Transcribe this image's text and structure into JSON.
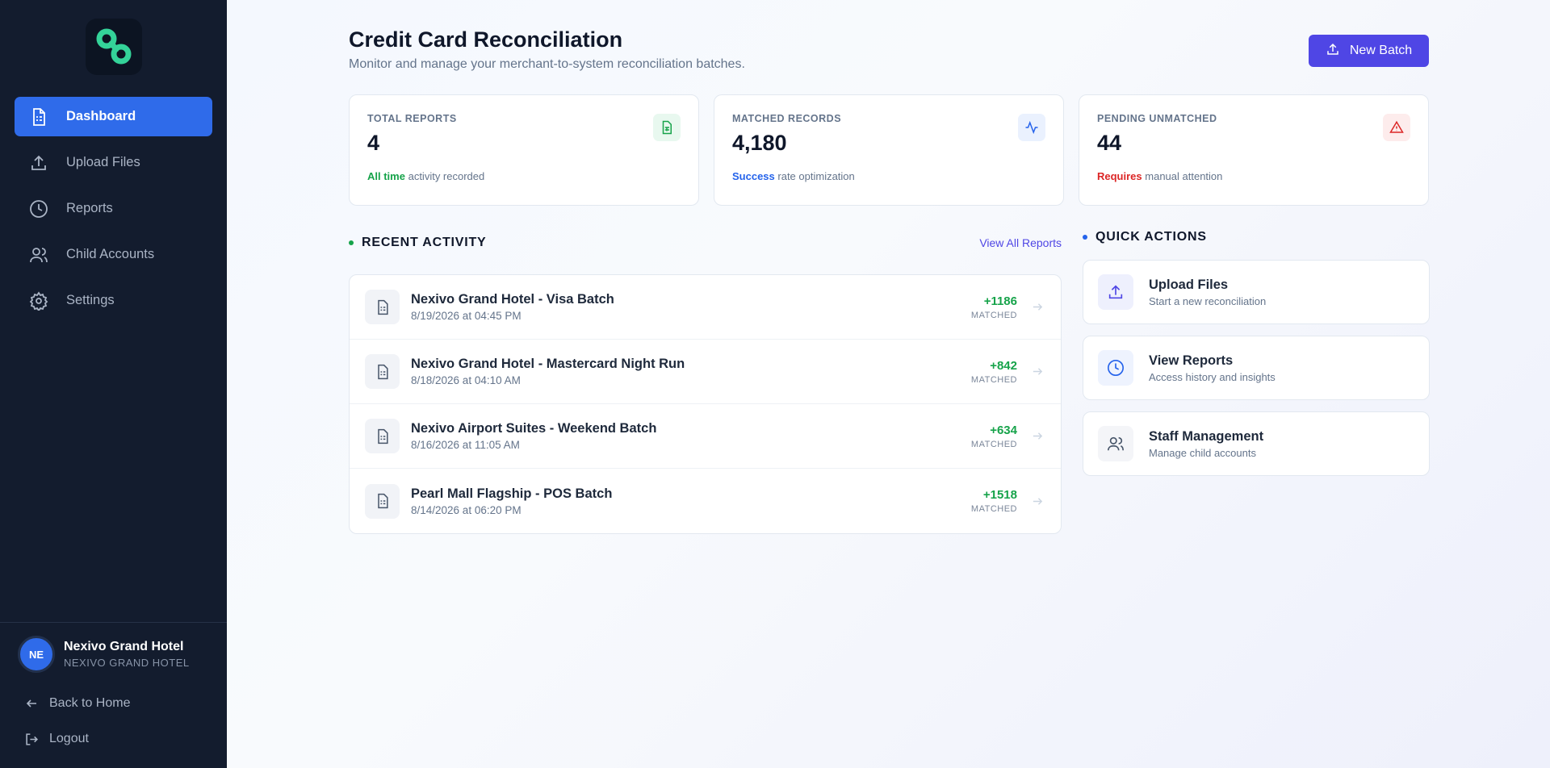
{
  "sidebar": {
    "nav": [
      {
        "label": "Dashboard",
        "icon": "document-icon",
        "active": true
      },
      {
        "label": "Upload Files",
        "icon": "upload-icon"
      },
      {
        "label": "Reports",
        "icon": "clock-icon"
      },
      {
        "label": "Child Accounts",
        "icon": "users-icon"
      },
      {
        "label": "Settings",
        "icon": "gear-icon"
      }
    ],
    "user": {
      "initials": "NE",
      "name": "Nexivo Grand Hotel",
      "org": "NEXIVO GRAND HOTEL"
    },
    "back_label": "Back to Home",
    "logout_label": "Logout"
  },
  "header": {
    "title": "Credit Card Reconciliation",
    "subtitle": "Monitor and manage your merchant-to-system reconciliation batches.",
    "new_batch_label": "New Batch"
  },
  "stats": [
    {
      "label": "TOTAL REPORTS",
      "value": "4",
      "note_strong": "All time",
      "note_rest": "activity recorded",
      "accent": "#16a34a"
    },
    {
      "label": "MATCHED RECORDS",
      "value": "4,180",
      "note_strong": "Success",
      "note_rest": "rate optimization",
      "accent": "#2563eb"
    },
    {
      "label": "PENDING UNMATCHED",
      "value": "44",
      "note_strong": "Requires",
      "note_rest": "manual attention",
      "accent": "#dc2626"
    }
  ],
  "recent": {
    "title": "RECENT ACTIVITY",
    "view_all": "View All Reports",
    "items": [
      {
        "title": "Nexivo Grand Hotel - Visa Batch",
        "date": "8/19/2026 at 04:45 PM",
        "count": "+1186",
        "status": "MATCHED"
      },
      {
        "title": "Nexivo Grand Hotel - Mastercard Night Run",
        "date": "8/18/2026 at 04:10 AM",
        "count": "+842",
        "status": "MATCHED"
      },
      {
        "title": "Nexivo Airport Suites - Weekend Batch",
        "date": "8/16/2026 at 11:05 AM",
        "count": "+634",
        "status": "MATCHED"
      },
      {
        "title": "Pearl Mall Flagship - POS Batch",
        "date": "8/14/2026 at 06:20 PM",
        "count": "+1518",
        "status": "MATCHED"
      }
    ]
  },
  "quick": {
    "title": "QUICK ACTIONS",
    "items": [
      {
        "title": "Upload Files",
        "sub": "Start a new reconciliation",
        "icon": "upload-icon"
      },
      {
        "title": "View Reports",
        "sub": "Access history and insights",
        "icon": "clock-icon"
      },
      {
        "title": "Staff Management",
        "sub": "Manage child accounts",
        "icon": "users-icon"
      }
    ]
  },
  "colors": {
    "accent": "#4f46e5",
    "sidebar": "#131c2e",
    "active": "#2f6bea",
    "logo": "#34d399"
  }
}
